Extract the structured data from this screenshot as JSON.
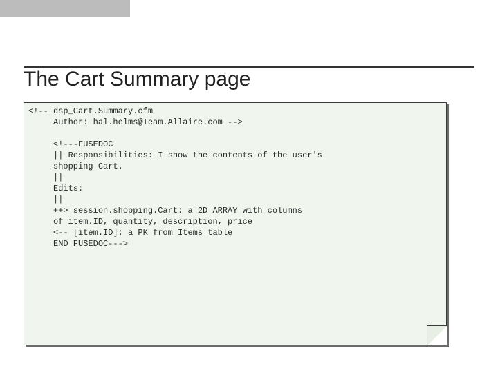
{
  "title": "The Cart Summary page",
  "code": {
    "line1": "<!-- dsp_Cart.Summary.cfm",
    "line2": "     Author: hal.helms@Team.Allaire.com -->",
    "blank_a": "",
    "line3": "     <!---FUSEDOC",
    "line4": "     || Responsibilities: I show the contents of the user's",
    "line5": "     shopping Cart.",
    "line6": "     ||",
    "line7": "     Edits:",
    "line8": "     ||",
    "line9": "     ++> session.shopping.Cart: a 2D ARRAY with columns",
    "line10": "     of item.ID, quantity, description, price",
    "line11": "     <-- [item.ID]: a PK from Items table",
    "line12": "     END FUSEDOC--->"
  }
}
